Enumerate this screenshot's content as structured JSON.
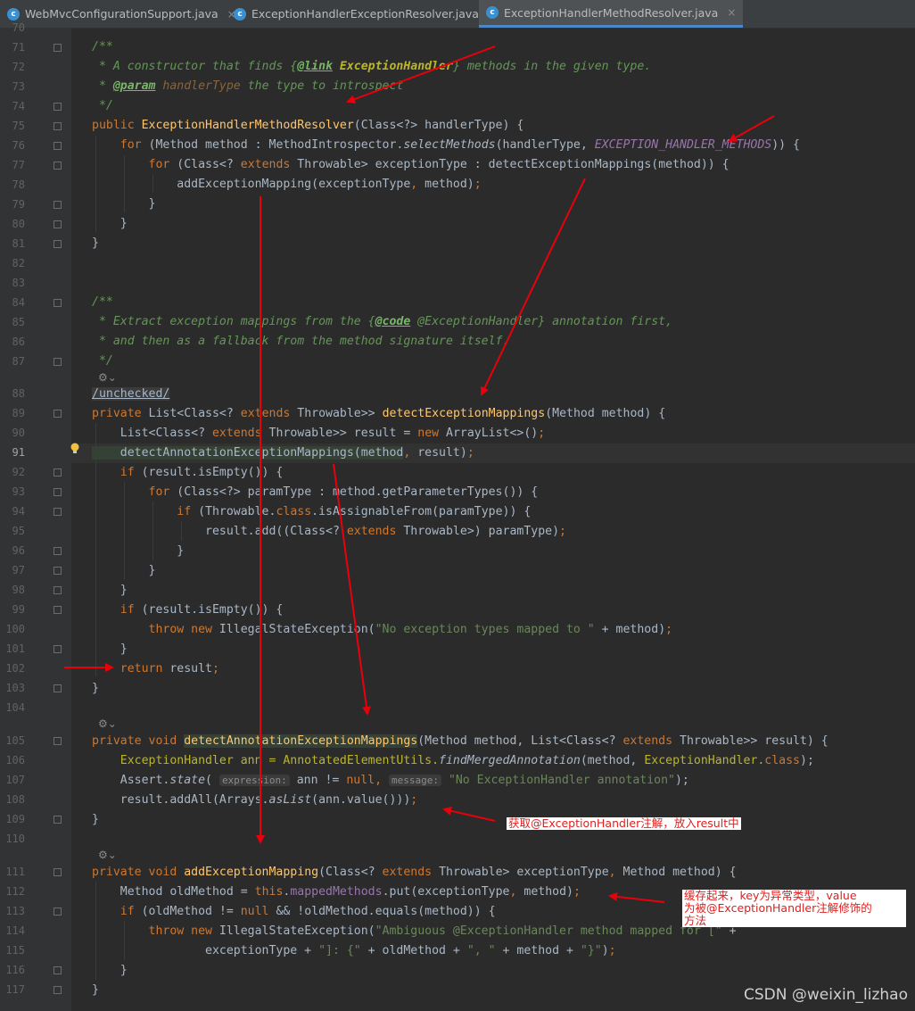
{
  "tabs": [
    {
      "label": "WebMvcConfigurationSupport.java",
      "active": false
    },
    {
      "label": "ExceptionHandlerExceptionResolver.java",
      "active": false
    },
    {
      "label": "ExceptionHandlerMethodResolver.java",
      "active": true
    }
  ],
  "tab_icon_letter": "c",
  "tab_close": "×",
  "line_numbers": [
    "70",
    "71",
    "72",
    "73",
    "74",
    "75",
    "76",
    "77",
    "78",
    "79",
    "80",
    "81",
    "82",
    "83",
    "84",
    "85",
    "86",
    "87",
    "88",
    "89",
    "90",
    "91",
    "92",
    "93",
    "94",
    "95",
    "96",
    "97",
    "98",
    "99",
    "100",
    "101",
    "102",
    "103",
    "104",
    "105",
    "106",
    "107",
    "108",
    "109",
    "110",
    "111",
    "112",
    "113",
    "114",
    "115",
    "116",
    "117"
  ],
  "current_line": "91",
  "code": {
    "c71": "/**",
    "c72a": " * A constructor that finds {",
    "c72b": "@link",
    "c72c": " ExceptionHandler",
    "c72d": "} methods in the given type.",
    "c73a": " * ",
    "c73b": "@param",
    "c73c": " handlerType",
    "c73d": " the type to introspect",
    "c74": " */",
    "c75a": "public ",
    "c75b": "ExceptionHandlerMethodResolver",
    "c75c": "(Class<?> handlerType) {",
    "c76a": "    for ",
    "c76b": "(Method method : MethodIntrospector.",
    "c76c": "selectMethods",
    "c76d": "(handlerType, ",
    "c76e": "EXCEPTION_HANDLER_METHODS",
    "c76f": ")) {",
    "c77a": "        for ",
    "c77b": "(Class<? ",
    "c77c": "extends ",
    "c77d": "Throwable> exceptionType : detectExceptionMappings(method)) {",
    "c78a": "            addExceptionMapping(exceptionType",
    "c78b": ", ",
    "c78c": "method)",
    "c78d": ";",
    "c79": "        }",
    "c80": "    }",
    "c81": "}",
    "c84": "/**",
    "c85a": " * Extract exception mappings from the {",
    "c85b": "@code",
    "c85c": " @ExceptionHandler} annotation first,",
    "c86": " * and then as a fallback from the method signature itself.",
    "c87": " */",
    "c88": "/unchecked/",
    "c89a": "private ",
    "c89b": "List<Class<? ",
    "c89c": "extends ",
    "c89d": "Throwable>> ",
    "c89e": "detectExceptionMappings",
    "c89f": "(Method method) {",
    "c90a": "    List<Class<? ",
    "c90b": "extends ",
    "c90c": "Throwable>> result = ",
    "c90d": "new ",
    "c90e": "ArrayList<>()",
    "c90f": ";",
    "c91a": "    detectAnnotationExceptionMappings(method",
    "c91b": ", ",
    "c91c": "result)",
    "c91d": ";",
    "c92a": "    if ",
    "c92b": "(result.isEmpty()) {",
    "c93a": "        for ",
    "c93b": "(Class<?> paramType : method.getParameterTypes()) {",
    "c94a": "            if ",
    "c94b": "(Throwable.",
    "c94c": "class",
    "c94d": ".isAssignableFrom(paramType)) {",
    "c95a": "                result.add((Class<? ",
    "c95b": "extends ",
    "c95c": "Throwable>) paramType)",
    "c95d": ";",
    "c96": "            }",
    "c97": "        }",
    "c98": "    }",
    "c99a": "    if ",
    "c99b": "(result.isEmpty()) {",
    "c100a": "        throw new ",
    "c100b": "IllegalStateException(",
    "c100c": "\"No exception types mapped to \"",
    "c100d": " + method)",
    "c100e": ";",
    "c101": "    }",
    "c102a": "    return ",
    "c102b": "result",
    "c102c": ";",
    "c103": "}",
    "c105a": "private void ",
    "c105b": "detectAnnotationExceptionMappings",
    "c105c": "(Method method, List<Class<? ",
    "c105d": "extends ",
    "c105e": "Throwable>> result) {",
    "c106a": "    ExceptionHandler ann = AnnotatedElementUtils.",
    "c106b": "findMergedAnnotation",
    "c106c": "(method, ",
    "c106d": "ExceptionHandler.",
    "c106e": "class",
    "c106f": ");",
    "c107a": "    Assert.",
    "c107b": "state",
    "c107c": "( ",
    "c107d": "expression:",
    "c107e": " ann != ",
    "c107f": "null, ",
    "c107g": "message:",
    "c107h": " \"No ExceptionHandler annotation\"",
    "c107i": ");",
    "c108a": "    result.addAll(Arrays.",
    "c108b": "asList",
    "c108c": "(ann.value()))",
    "c108d": ";",
    "c109": "}",
    "c111a": "private void ",
    "c111b": "addExceptionMapping",
    "c111c": "(Class<? ",
    "c111d": "extends ",
    "c111e": "Throwable> exceptionType",
    "c111f": ", ",
    "c111g": "Method method) {",
    "c112a": "    Method oldMethod = ",
    "c112b": "this",
    "c112c": ".",
    "c112d": "mappedMethods",
    "c112e": ".put(exceptionType",
    "c112f": ", ",
    "c112g": "method)",
    "c112h": ";",
    "c113a": "    if ",
    "c113b": "(oldMethod != ",
    "c113c": "null ",
    "c113d": "&& !oldMethod.equals(method)) {",
    "c114a": "        throw new ",
    "c114b": "IllegalStateException(",
    "c114c": "\"Ambiguous @ExceptionHandler method mapped for [\"",
    "c114d": " +",
    "c115a": "                exceptionType + ",
    "c115b": "\"]: {\"",
    "c115c": " + oldMethod + ",
    "c115d": "\", \"",
    "c115e": " + method + ",
    "c115f": "\"}\"",
    "c115g": ")",
    "c115h": ";",
    "c116": "    }",
    "c117": "}"
  },
  "inline_icon": "⚙⌄",
  "annotations": {
    "note1": "获取@ExceptionHandler注解，放入result中",
    "note2_l1": "缓存起来，key为异常类型，value",
    "note2_l2": "为被@ExceptionHandler注解修饰的",
    "note2_l3": "方法"
  },
  "watermark": "CSDN @weixin_lizhao",
  "colors": {
    "arrow": "#e8000b",
    "keyword": "#cc7832",
    "method": "#ffc66d",
    "comment": "#629755",
    "string": "#6a8759",
    "constant": "#9876aa"
  }
}
